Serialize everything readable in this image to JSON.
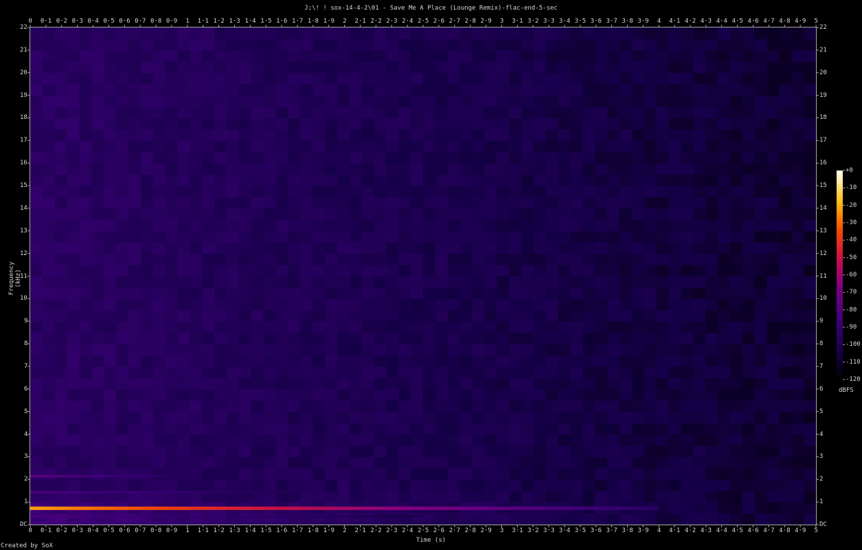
{
  "chart_data": {
    "type": "heatmap",
    "title": "J;\\! ! sox-14-4-2\\01 - Save Me A Place (Lounge Remix)-flac-end-5-sec",
    "xlabel": "Time (s)",
    "ylabel": "Frequency (kHz)",
    "xlim": [
      0,
      5
    ],
    "ylim": [
      0,
      22
    ],
    "x_ticks": [
      "0",
      "0·1",
      "0·2",
      "0·3",
      "0·4",
      "0·5",
      "0·6",
      "0·7",
      "0·8",
      "0·9",
      "1",
      "1·1",
      "1·2",
      "1·3",
      "1·4",
      "1·5",
      "1·6",
      "1·7",
      "1·8",
      "1·9",
      "2",
      "2·1",
      "2·2",
      "2·3",
      "2·4",
      "2·5",
      "2·6",
      "2·7",
      "2·8",
      "2·9",
      "3",
      "3·1",
      "3·2",
      "3·3",
      "3·4",
      "3·5",
      "3·6",
      "3·7",
      "3·8",
      "3·9",
      "4",
      "4·1",
      "4·2",
      "4·3",
      "4·4",
      "4·5",
      "4·6",
      "4·7",
      "4·8",
      "4·9",
      "5"
    ],
    "y_ticks": [
      "DC",
      "1",
      "2",
      "3",
      "4",
      "5",
      "6",
      "7",
      "8",
      "9",
      "10",
      "11",
      "12",
      "13",
      "14",
      "15",
      "16",
      "17",
      "18",
      "19",
      "20",
      "21",
      "22"
    ],
    "colorbar": {
      "label": "dBFS",
      "range": [
        -120,
        0
      ],
      "ticks": [
        "+0",
        "-10",
        "-20",
        "-30",
        "-40",
        "-50",
        "-60",
        "-70",
        "-80",
        "-90",
        "-100",
        "-110",
        "-120"
      ]
    },
    "noise_floor_dbfs_start": -95,
    "noise_floor_dbfs_end": -110,
    "tones": [
      {
        "freq_khz": 0.72,
        "t_start": 0,
        "t_end": 4.0,
        "dbfs_start": -22,
        "dbfs_end": -95
      },
      {
        "freq_khz": 2.14,
        "t_start": 0,
        "t_end": 1.1,
        "dbfs_start": -75,
        "dbfs_end": -100
      },
      {
        "freq_khz": 1.43,
        "t_start": 0,
        "t_end": 1.7,
        "dbfs_start": -80,
        "dbfs_end": -100
      },
      {
        "freq_khz": 0.36,
        "t_start": 0,
        "t_end": 2.5,
        "dbfs_start": -82,
        "dbfs_end": -105
      },
      {
        "freq_khz": 0.08,
        "t_start": 0,
        "t_end": 3.0,
        "dbfs_start": -85,
        "dbfs_end": -105
      }
    ]
  },
  "footer": {
    "credit": "Created by SoX"
  }
}
